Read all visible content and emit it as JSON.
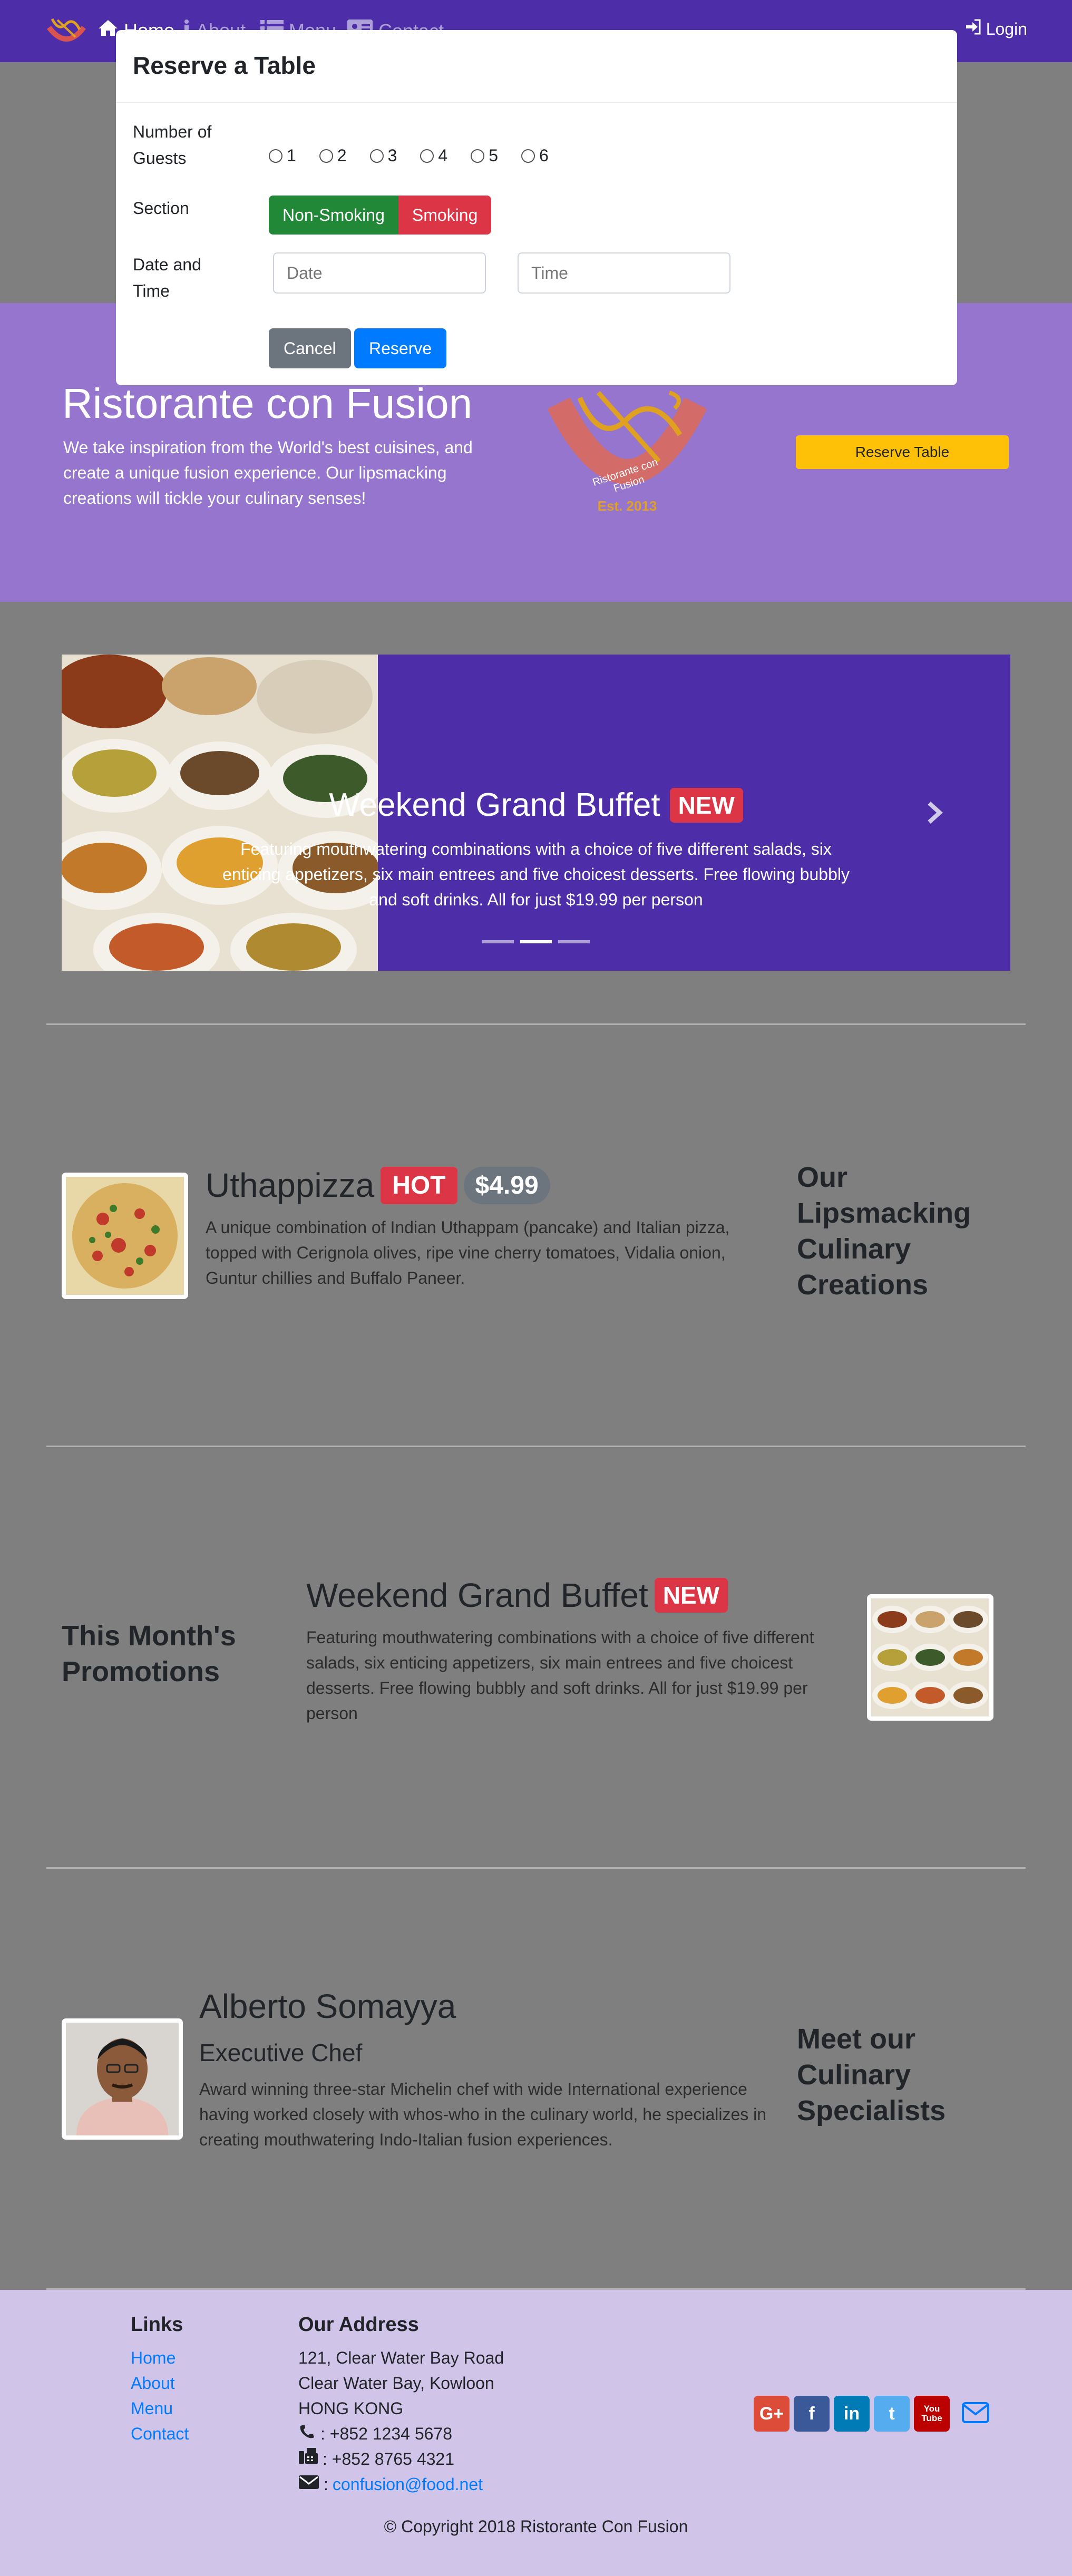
{
  "navbar": {
    "links": [
      {
        "label": "Home",
        "icon": "home-icon"
      },
      {
        "label": "About",
        "icon": "info-icon"
      },
      {
        "label": "Menu",
        "icon": "list-icon"
      },
      {
        "label": "Contact",
        "icon": "address-card-icon"
      }
    ],
    "login": "Login"
  },
  "jumbotron": {
    "title": "Ristorante con Fusion",
    "text": "We take inspiration from the World's best cuisines, and create a unique fusion experience. Our lipsmacking creations will tickle your culinary senses!",
    "logo_text": "Ristorante con Fusion",
    "logo_est": "Est. 2013",
    "reserve_button": "Reserve Table"
  },
  "carousel": {
    "title": "Weekend Grand Buffet",
    "badge": "NEW",
    "text": "Featuring mouthwatering combinations with a choice of five different salads, six enticing appetizers, six main entrees and five choicest desserts. Free flowing bubbly and soft drinks. All for just $19.99 per person",
    "active_index": 1
  },
  "dish": {
    "title": "Uthappizza",
    "badge_hot": "HOT",
    "price": "$4.99",
    "text": "A unique combination of Indian Uthappam (pancake) and Italian pizza, topped with Cerignola olives, ripe vine cherry tomatoes, Vidalia onion, Guntur chillies and Buffalo Paneer.",
    "side_heading": "Our Lipsmacking Culinary Creations"
  },
  "promotion": {
    "side_heading": "This Month's Promotions",
    "title": "Weekend Grand Buffet",
    "badge": "NEW",
    "text": "Featuring mouthwatering combinations with a choice of five different salads, six enticing appetizers, six main entrees and five choicest desserts. Free flowing bubbly and soft drinks. All for just $19.99 per person"
  },
  "leader": {
    "name": "Alberto Somayya",
    "designation": "Executive Chef",
    "text": "Award winning three-star Michelin chef with wide International experience having worked closely with whos-who in the culinary world, he specializes in creating mouthwatering Indo-Italian fusion experiences.",
    "side_heading": "Meet our Culinary Specialists"
  },
  "footer": {
    "links_heading": "Links",
    "links": [
      "Home",
      "About",
      "Menu",
      "Contact"
    ],
    "address_heading": "Our Address",
    "address": [
      "121, Clear Water Bay Road",
      "Clear Water Bay, Kowloon",
      "HONG KONG"
    ],
    "phone": ": +852 1234 5678",
    "fax": ": +852 8765 4321",
    "email_prefix": ": ",
    "email": "confusion@food.net",
    "copyright": "© Copyright 2018 Ristorante Con Fusion",
    "social": [
      {
        "name": "google-plus-icon",
        "label": "G+",
        "color": "#dd4b39"
      },
      {
        "name": "facebook-icon",
        "label": "f",
        "color": "#3b5998"
      },
      {
        "name": "linkedin-icon",
        "label": "in",
        "color": "#007bb6"
      },
      {
        "name": "twitter-icon",
        "label": "t",
        "color": "#55acee"
      },
      {
        "name": "youtube-icon",
        "label": "You Tube",
        "color": "#bb0000"
      }
    ]
  },
  "modal": {
    "title": "Reserve a Table",
    "guests_label": "Number of Guests",
    "guest_options": [
      "1",
      "2",
      "3",
      "4",
      "5",
      "6"
    ],
    "section_label": "Section",
    "non_smoking": "Non-Smoking",
    "smoking": "Smoking",
    "datetime_label": "Date and Time",
    "date_placeholder": "Date",
    "time_placeholder": "Time",
    "cancel": "Cancel",
    "reserve": "Reserve"
  },
  "colors": {
    "navbar": "#4d2da8",
    "jumbotron": "#9575cd",
    "footer": "#d1c4e9",
    "overlay": "#7f7f7f",
    "warning": "#ffc107",
    "success": "#218838",
    "danger": "#dc3545",
    "primary": "#007bff"
  }
}
